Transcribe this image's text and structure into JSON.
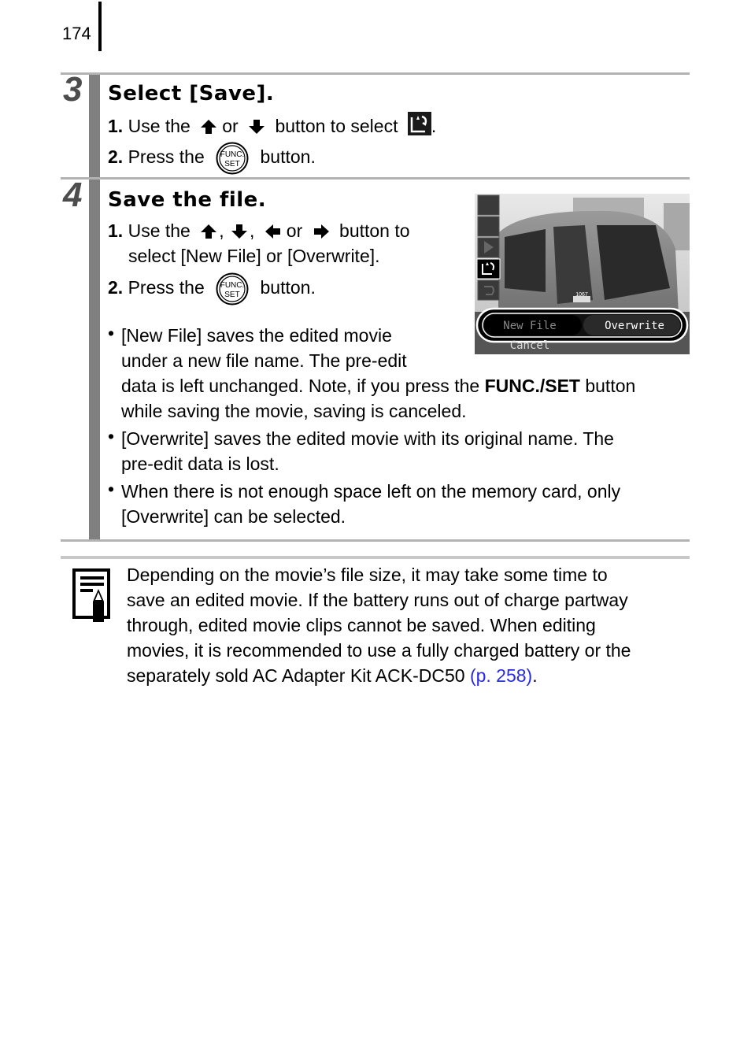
{
  "page": {
    "number": "174"
  },
  "steps": [
    {
      "number": "3",
      "title": "Select [Save].",
      "instructions": [
        {
          "num": "1.",
          "pre": "Use the",
          "mid": "or",
          "post": "button to select",
          "end": "."
        },
        {
          "num": "2.",
          "pre": "Press the",
          "post": "button."
        }
      ]
    },
    {
      "number": "4",
      "title": "Save the file.",
      "instructions": [
        {
          "num": "1.",
          "pre": "Use the",
          "sep1": ",",
          "sep2": ",",
          "mid": "or",
          "post": "button to",
          "line2": "select [New File] or [Overwrite]."
        },
        {
          "num": "2.",
          "pre": "Press the",
          "post": "button."
        }
      ],
      "bullets": [
        {
          "lines": [
            "[New File] saves the edited movie",
            "under a new file name. The pre-edit"
          ],
          "line3_pre": "data is left unchanged. Note, if you press the ",
          "line3_bold": "FUNC./SET",
          "line3_post": " button",
          "line4": "while saving the movie, saving is canceled."
        },
        {
          "lines": [
            "[Overwrite] saves the edited movie with its original name. The",
            "pre-edit data is lost."
          ]
        },
        {
          "lines": [
            "When there is not enough space left on the memory card, only",
            "[Overwrite] can be selected."
          ]
        }
      ]
    }
  ],
  "icons": {
    "func_set_label_top": "FUNC.",
    "func_set_label_bottom": "SET",
    "bullet": "•"
  },
  "camera_screen": {
    "menu_icons": [
      "cut-front-icon",
      "cut-back-icon",
      "play-icon",
      "save-icon",
      "undo-icon"
    ],
    "selected_icon_index": 3,
    "options": [
      "New File",
      "Overwrite"
    ],
    "selected_option": "Overwrite",
    "cancel_label": "Cancel",
    "train_number": "1067"
  },
  "note": {
    "lines": [
      "Depending on the movie’s file size, it may take some time to",
      "save an edited movie. If the battery runs out of charge partway",
      "through, edited movie clips cannot be saved. When editing",
      "movies, it is recommended to use a fully charged battery or the"
    ],
    "last_line": "separately sold AC Adapter Kit ACK-DC50 ",
    "link": "(p. 258)",
    "end": ".",
    "link_color": "#2a2ae6"
  }
}
